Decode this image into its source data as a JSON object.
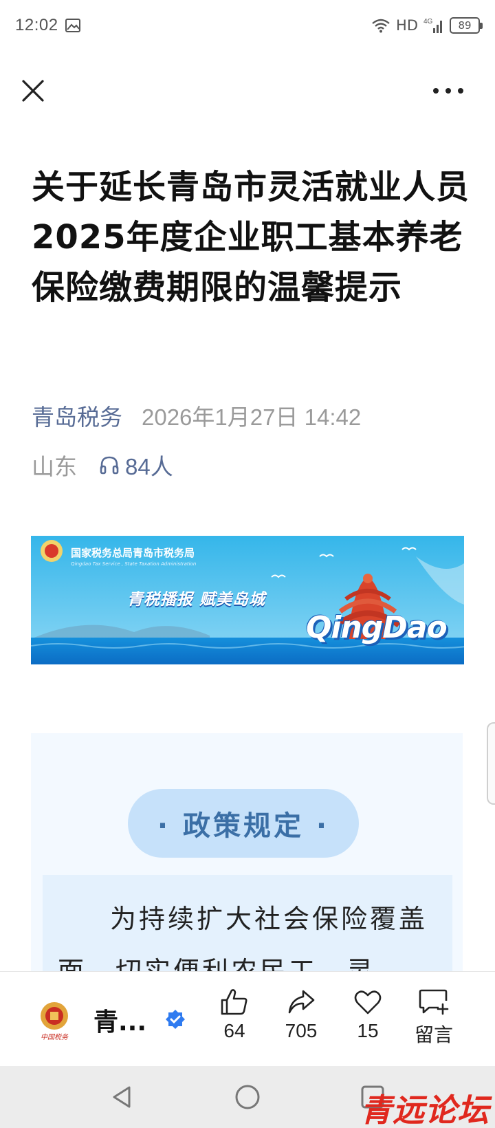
{
  "status_bar": {
    "time": "12:02",
    "network": "HD",
    "signal_label": "4G",
    "battery": "89",
    "icons": [
      "gallery-icon",
      "wifi-icon",
      "signal-icon",
      "battery-icon"
    ]
  },
  "nav": {
    "close_icon": "close-icon",
    "more_icon": "more-icon"
  },
  "article": {
    "title": "关于延长青岛市灵活就业人员2025年度企业职工基本养老保险缴费期限的温馨提示",
    "account": "青岛税务",
    "date": "2026年1月27日 14:42",
    "region": "山东",
    "listeners": "84人"
  },
  "banner": {
    "org_cn": "国家税务总局青岛市税务局",
    "org_en": "Qingdao Tax Service , State Taxation Administration",
    "slogan": "青税播报  赋美岛城",
    "brand": "QingDao",
    "colors": {
      "sky": "#2ea7e0",
      "sea": "#0e7fd3",
      "tower": "#d9442b"
    }
  },
  "content": {
    "section_title": "· 政策规定 ·",
    "paragraph": "为持续扩大社会保险覆盖面，切实便利农民工、灵"
  },
  "action_bar": {
    "account_short": "青...",
    "like_count": "64",
    "share_count": "705",
    "love_count": "15",
    "comment_label": "留言",
    "accent": "#2f7bf0"
  },
  "watermark": "青远论坛"
}
